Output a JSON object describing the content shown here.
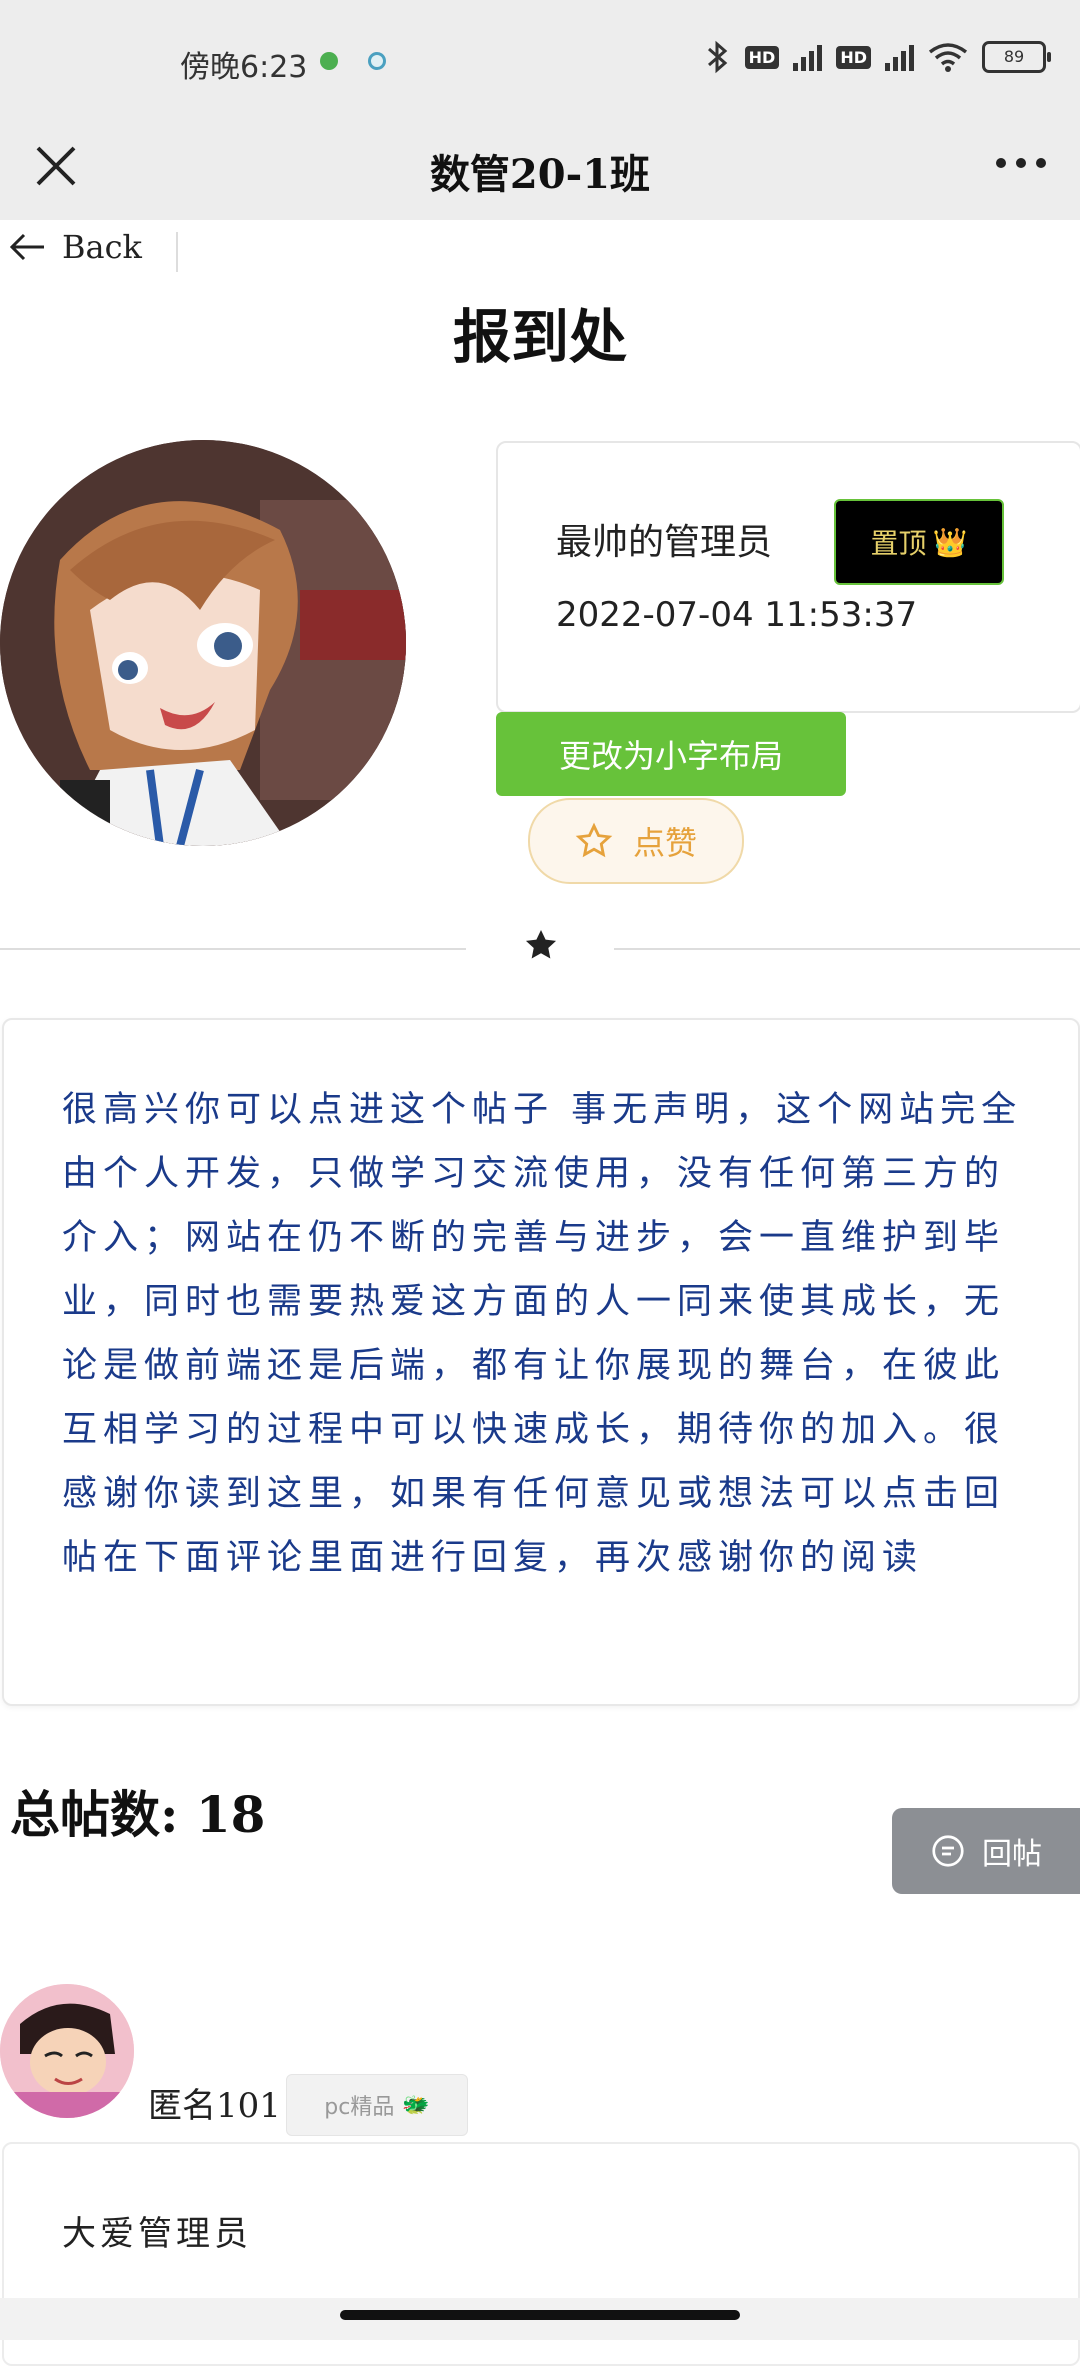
{
  "status_bar": {
    "time": "傍晚6:23",
    "battery": "89",
    "hd1": "HD",
    "hd2": "HD"
  },
  "navbar": {
    "title": "数管20-1班"
  },
  "back_label": "Back",
  "page_title": "报到处",
  "post": {
    "author_name": "最帅的管理员",
    "pinned_label": "置顶",
    "pinned_icon": "👑",
    "timestamp": "2022-07-04 11:53:37",
    "layout_button": "更改为小字布局",
    "like_button": "点赞",
    "content": "很高兴你可以点进这个帖子 事无声明，这个网站完全由个人开发，只做学习交流使用，没有任何第三方的介入；网站在仍不断的完善与进步，会一直维护到毕业，同时也需要热爱这方面的人一同来使其成长，无论是做前端还是后端，都有让你展现的舞台，在彼此互相学习的过程中可以快速成长，期待你的加入。很感谢你读到这里，如果有任何意见或想法可以点击回帖在下面评论里面进行回复，再次感谢你的阅读"
  },
  "total_label": "总帖数: 18",
  "reply_button": "回帖",
  "reply": {
    "author": "匿名101",
    "tag": "pc精品",
    "tag_icon": "🐲",
    "text": "大爱管理员"
  },
  "colors": {
    "accent_green": "#67c23a",
    "content_blue": "#1a3a8a",
    "like_orange": "#e6a23c"
  }
}
